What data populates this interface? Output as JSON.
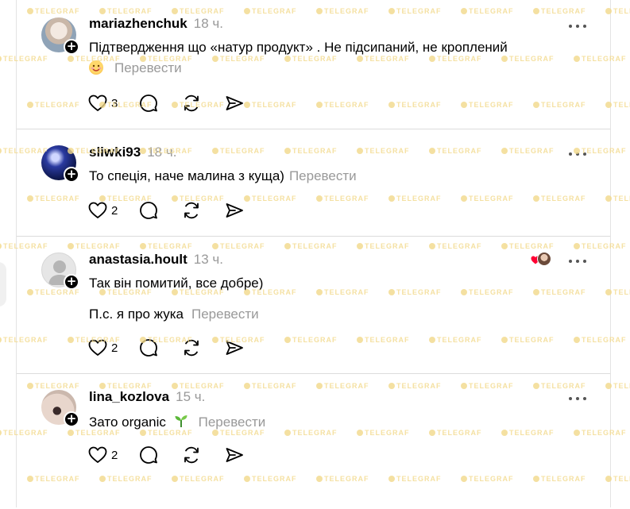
{
  "comments": [
    {
      "username": "mariazhenchuk",
      "time": "18 ч.",
      "lines": [
        "Підтвердження що «натур продукт» . Не підсипаний, не кроплений"
      ],
      "emoji_line": true,
      "translate": "Перевести",
      "likes": "3",
      "liked": false
    },
    {
      "username": "sliwki93",
      "time": "18 ч.",
      "lines": [
        "То спеція, наче малина з куща)"
      ],
      "translate": "Перевести",
      "likes": "2"
    },
    {
      "username": "anastasia.hoult",
      "time": "13 ч.",
      "lines": [
        "Так він помитий, все добре)",
        "П.с. я про жука"
      ],
      "translate": "Перевести",
      "likes": "2",
      "author_liked": true
    },
    {
      "username": "lina_kozlova",
      "time": "15 ч.",
      "lines": [
        "Зато organic"
      ],
      "translate": "Перевести",
      "likes": "2"
    }
  ],
  "watermark": "TELEGRAF",
  "icons": {
    "like": "heart-icon",
    "reply": "comment-bubble-icon",
    "repost": "repost-icon",
    "share": "send-icon",
    "more": "more-dots-icon",
    "follow": "plus-icon"
  },
  "colors": {
    "meta_gray": "#999999",
    "divider": "#dcdcdc",
    "heart_red": "#ff0033",
    "watermark": "#f2d98a"
  }
}
